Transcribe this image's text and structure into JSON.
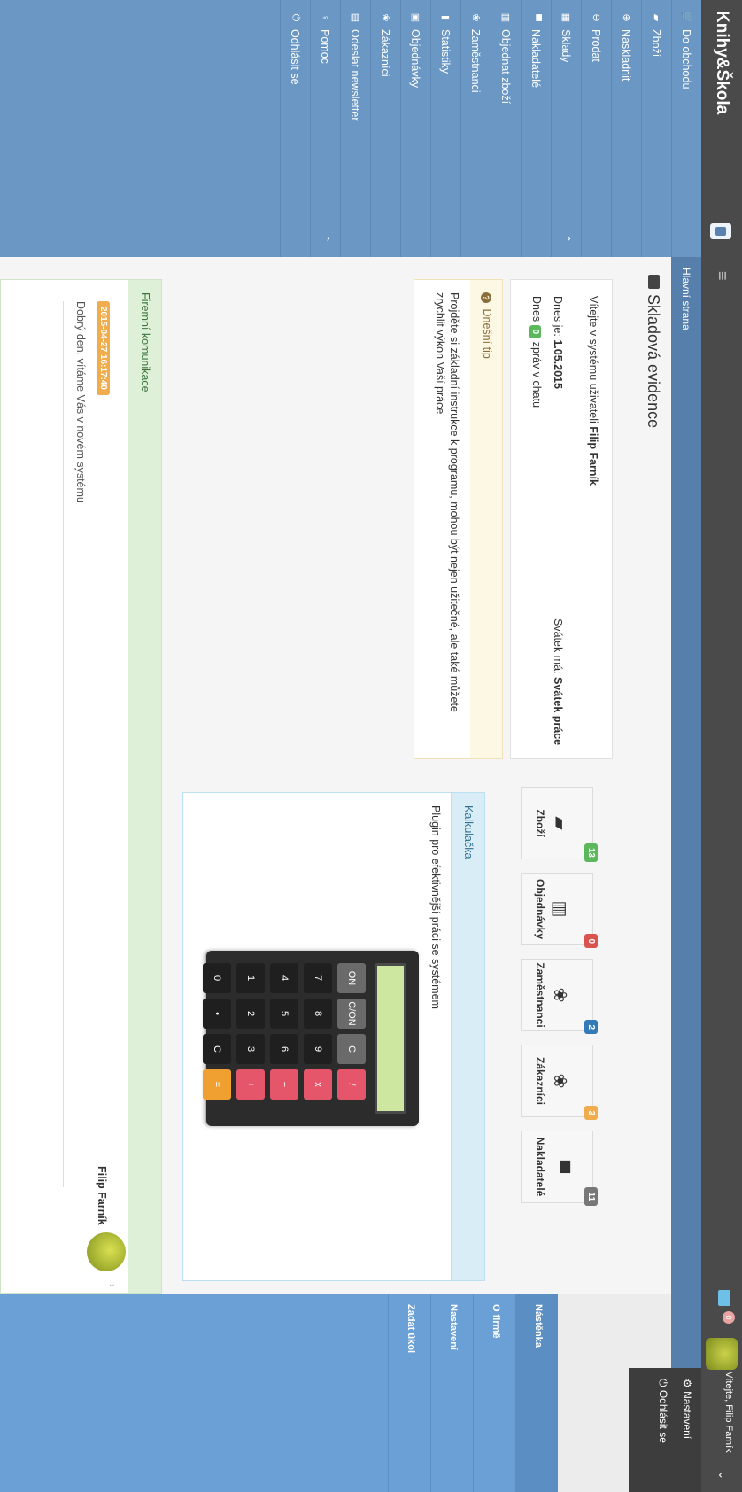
{
  "brand": {
    "title": "Knihy&Škola"
  },
  "sidebar": {
    "items": [
      {
        "label": "Do obchodu",
        "icon": "cart-icon",
        "glyph": "🛒"
      },
      {
        "label": "Zboží",
        "icon": "book-icon",
        "glyph": "▰"
      },
      {
        "label": "Naskladnit",
        "icon": "plus-circle-icon",
        "glyph": "⊕"
      },
      {
        "label": "Prodat",
        "icon": "minus-circle-icon",
        "glyph": "⊖"
      },
      {
        "label": "Sklady",
        "icon": "grid-icon",
        "glyph": "▦",
        "chevron": "⌃"
      },
      {
        "label": "Nakladatelé",
        "icon": "truck-icon",
        "glyph": "▀"
      },
      {
        "label": "Objednat zboží",
        "icon": "barcode-icon",
        "glyph": "▥"
      },
      {
        "label": "Zaměstnanci",
        "icon": "users-icon",
        "glyph": "❀"
      },
      {
        "label": "Statistiky",
        "icon": "chart-icon",
        "glyph": "▮"
      },
      {
        "label": "Objednávky",
        "icon": "orders-icon",
        "glyph": "▣"
      },
      {
        "label": "Zákazníci",
        "icon": "customers-icon",
        "glyph": "❀"
      },
      {
        "label": "Odeslat newsletter",
        "icon": "newsletter-icon",
        "glyph": "▤"
      },
      {
        "label": "Pomoc",
        "icon": "help-icon",
        "glyph": "♀",
        "chevron": "⌃"
      },
      {
        "label": "Odhlásit se",
        "icon": "power-icon",
        "glyph": "⏻"
      }
    ]
  },
  "topbar": {
    "menu_glyph": "≡",
    "mail_badge": "0",
    "user_welcome": "Vítejte, Filip Farník",
    "caret": "⌄",
    "dropdown": {
      "settings": "Nastavení",
      "logout": "Odhlásit se",
      "settings_glyph": "⚙",
      "logout_glyph": "⏻"
    }
  },
  "breadcrumb": "Hlavní strana",
  "right_tabs": [
    "Nástěnka",
    "O firmě",
    "Nastavení",
    "Zadat úkol"
  ],
  "page": {
    "title": "Skladová evidence"
  },
  "welcome": {
    "prefix": "Vítejte v systému uživateli ",
    "user": "Filip Farník",
    "date_prefix": "Dnes je: ",
    "date": "1.05.2015",
    "chat_prefix": "Dnes ",
    "chat_count": "0",
    "chat_suffix": " zpráv v chatu",
    "holiday_prefix": "Svátek má: ",
    "holiday": "Svátek práce"
  },
  "tip": {
    "title": "Dnešní tip",
    "icon_glyph": "?",
    "text": "Projděte si základní instrukce k programu, mohou být nejen užitečné, ale také můžete zrychlit výkon Vaší práce"
  },
  "tiles": [
    {
      "label": "Zboží",
      "badge": "13",
      "badge_color": "#5cb85c",
      "glyph": "▰",
      "icon": "book-icon"
    },
    {
      "label": "Objednávky",
      "badge": "0",
      "badge_color": "#d9534f",
      "glyph": "▥",
      "icon": "barcode-icon"
    },
    {
      "label": "Zaměstnanci",
      "badge": "2",
      "badge_color": "#337ab7",
      "glyph": "❀",
      "icon": "users-icon"
    },
    {
      "label": "Zákazníci",
      "badge": "3",
      "badge_color": "#f0ad4e",
      "glyph": "❀",
      "icon": "customers-icon"
    },
    {
      "label": "Nakladatelé",
      "badge": "11",
      "badge_color": "#777777",
      "glyph": "▀",
      "icon": "truck-icon"
    }
  ],
  "calculator": {
    "title": "Kalkulačka",
    "subtitle": "Plugin pro efektivnější práci se systémem",
    "rows": [
      [
        "ON",
        "C/ON",
        "C",
        "/"
      ],
      [
        "7",
        "8",
        "9",
        "x"
      ],
      [
        "4",
        "5",
        "6",
        "−"
      ],
      [
        "1",
        "2",
        "3",
        "+"
      ],
      [
        "0",
        "•",
        "C",
        "="
      ]
    ]
  },
  "comm": {
    "title": "Firemní komunikace",
    "date": "2015-04-27 16:17:40",
    "message": "Dobrý den, vítáme Vás v novém systému",
    "author": "Filip Farník",
    "chevron": "›"
  }
}
